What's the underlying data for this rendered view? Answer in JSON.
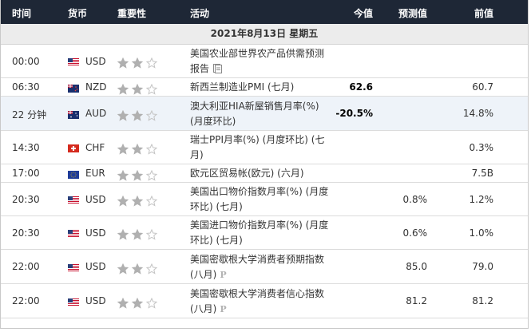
{
  "header": {
    "time": "时间",
    "currency": "货币",
    "importance": "重要性",
    "event": "活动",
    "actual": "今值",
    "forecast": "预测值",
    "previous": "前值"
  },
  "date_label": "2021年8月13日 星期五",
  "colors": {
    "header_bg": "#1e2736",
    "highlight_row": "#eef3f9",
    "star_filled": "#b0b0b0"
  },
  "rows": [
    {
      "time": "00:00",
      "flag": "us-flag",
      "currency": "USD",
      "stars": 2,
      "event": "美国农业部世界农产品供需预测报告",
      "icon": "document-icon",
      "actual": "",
      "forecast": "",
      "previous": ""
    },
    {
      "time": "06:30",
      "flag": "nz-flag",
      "currency": "NZD",
      "stars": 2,
      "event": "新西兰制造业PMI (七月)",
      "actual": "62.6",
      "forecast": "",
      "previous": "60.7"
    },
    {
      "time": "22 分钟",
      "flag": "au-flag",
      "currency": "AUD",
      "stars": 2,
      "event": "澳大利亚HIA新屋销售月率(%) (月度环比)",
      "actual": "-20.5%",
      "forecast": "",
      "previous": "14.8%"
    },
    {
      "time": "14:30",
      "flag": "ch-flag",
      "currency": "CHF",
      "stars": 2,
      "event": "瑞士PPI月率(%) (月度环比) (七月)",
      "actual": "",
      "forecast": "",
      "previous": "0.3%"
    },
    {
      "time": "17:00",
      "flag": "eu-flag",
      "currency": "EUR",
      "stars": 2,
      "event": "欧元区贸易帐(欧元) (六月)",
      "actual": "",
      "forecast": "",
      "previous": "7.5B"
    },
    {
      "time": "20:30",
      "flag": "us-flag",
      "currency": "USD",
      "stars": 2,
      "event": "美国出口物价指数月率(%) (月度环比) (七月)",
      "actual": "",
      "forecast": "0.8%",
      "previous": "1.2%"
    },
    {
      "time": "20:30",
      "flag": "us-flag",
      "currency": "USD",
      "stars": 2,
      "event": "美国进口物价指数月率(%) (月度环比) (七月)",
      "actual": "",
      "forecast": "0.6%",
      "previous": "1.0%"
    },
    {
      "time": "22:00",
      "flag": "us-flag",
      "currency": "USD",
      "stars": 2,
      "event": "美国密歇根大学消费者预期指数 (八月)",
      "prelim": "P",
      "actual": "",
      "forecast": "85.0",
      "previous": "79.0"
    },
    {
      "time": "22:00",
      "flag": "us-flag",
      "currency": "USD",
      "stars": 2,
      "event": "美国密歇根大学消费者信心指数 (八月)",
      "prelim": "P",
      "actual": "",
      "forecast": "81.2",
      "previous": "81.2"
    }
  ]
}
